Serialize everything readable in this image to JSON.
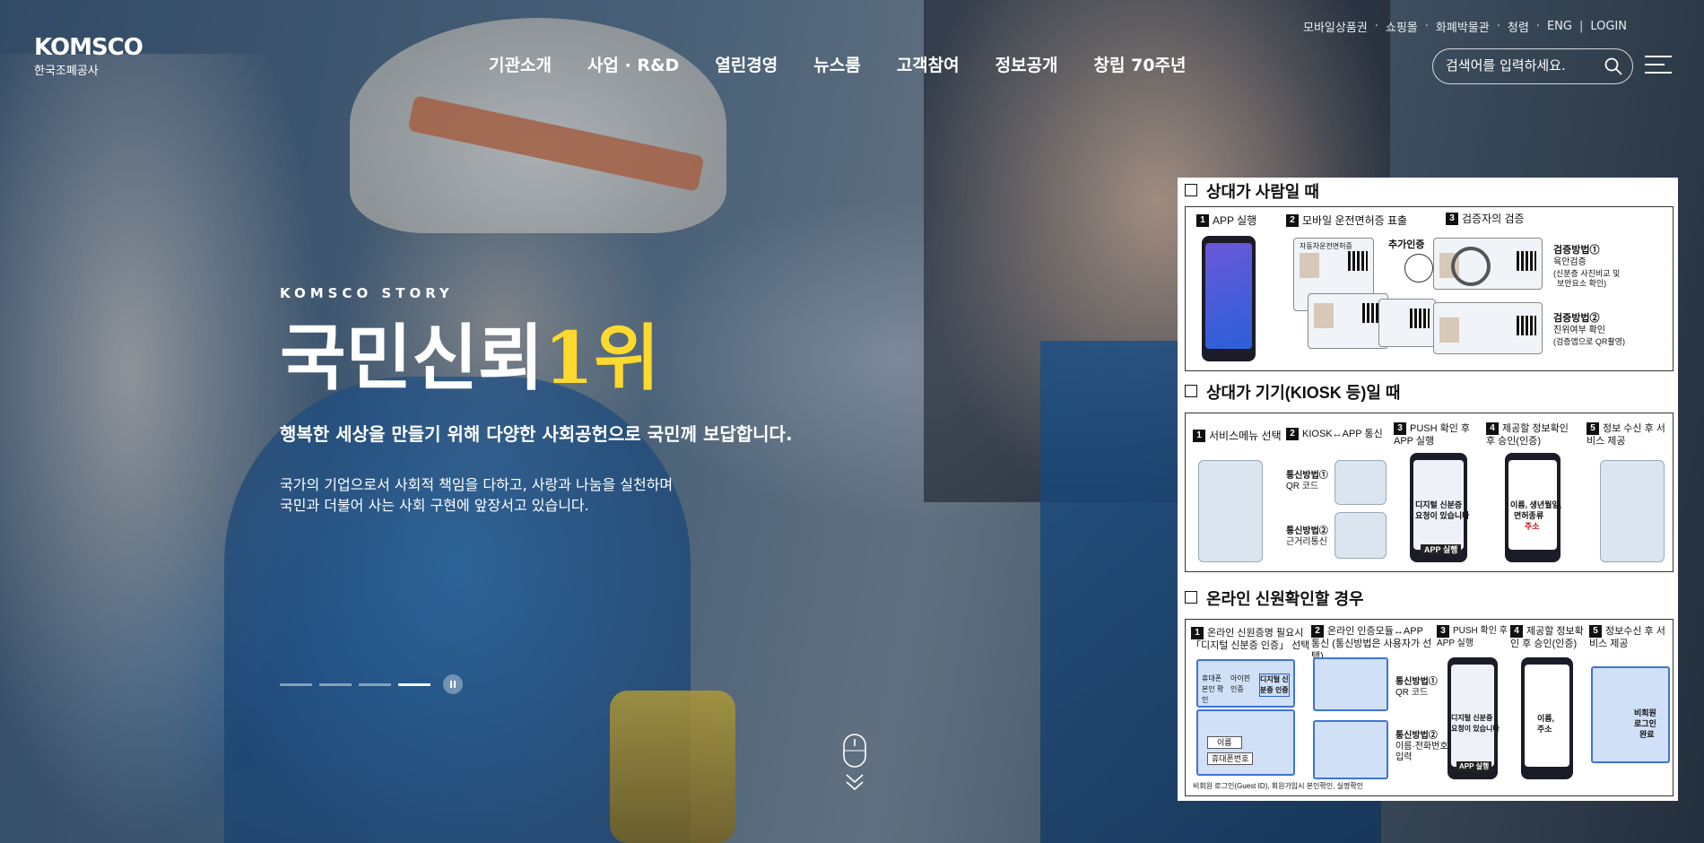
{
  "header": {
    "logo_mark": "KOMSCO",
    "logo_sub": "한국조폐공사",
    "nav": [
      "기관소개",
      "사업 · R&D",
      "열린경영",
      "뉴스룸",
      "고객참여",
      "정보공개",
      "창립 70주년"
    ],
    "util_links": [
      "모바일상품권",
      "쇼핑몰",
      "화폐박물관",
      "청렴",
      "ENG",
      "LOGIN"
    ],
    "search_placeholder": "검색어를 입력하세요."
  },
  "hero": {
    "kicker": "KOMSCO STORY",
    "title_main": "국민신뢰",
    "title_highlight": "1위",
    "lead": "행복한 세상을 만들기 위해 다양한 사회공헌으로 국민께 보답합니다.",
    "desc": [
      "국가의 기업으로서 사회적 책임을 다하고, 사랑과 나눔을 실천하며",
      "국민과 더불어 사는 사회 구현에 앞장서고 있습니다."
    ],
    "slide_count": 4,
    "active_slide": 4
  },
  "overlay": {
    "section1": {
      "title": "상대가 사람일 때",
      "steps": [
        "APP 실행",
        "모바일 운전면허증 표출",
        "검증자의 검증"
      ],
      "extra_auth": "추가인증",
      "license_title": "자동차운전면허증",
      "method1_title": "검증방법①",
      "method1_desc": [
        "육안검증",
        "(신분증 사진비교 및",
        "보안요소 확인)"
      ],
      "method2_title": "검증방법②",
      "method2_desc": [
        "진위여부 확인",
        "(검증앱으로 QR촬영)"
      ]
    },
    "section2": {
      "title": "상대가 기기(KIOSK 등)일 때",
      "steps": [
        "서비스메뉴 선택",
        "KIOSK↔APP 통신",
        "PUSH 확인 후 APP 실행",
        "제공할 정보확인 후 승인(인증)",
        "정보 수신 후 서비스 제공"
      ],
      "comm1_title": "통신방법①",
      "comm1_desc": "QR 코드",
      "comm2_title": "통신방법②",
      "comm2_desc": "근거리통신",
      "push_text": [
        "디지털 신분증",
        "요청이 있습니다"
      ],
      "app_run": "APP 실행",
      "consent_text": [
        "이름, 생년월일,",
        "면허종류",
        "주소"
      ]
    },
    "section3": {
      "title": "온라인 신원확인할 경우",
      "steps": [
        "온라인 신원증명 필요시 「디지털 신분증 인증」 선택",
        "온라인 인증모듈↔APP 통신 (통신방법은 사용자가 선택)",
        "PUSH 확인 후 APP 실행",
        "제공할 정보확인 후 승인(인증)",
        "정보수신 후 서비스 제공"
      ],
      "comm1_title": "통신방법①",
      "comm1_desc": "QR 코드",
      "comm2_title": "통신방법②",
      "comm2_desc": [
        "이름·전화번호",
        "입력"
      ],
      "login_options": [
        "휴대폰 본인 확인",
        "아이핀 인증",
        "디지털 신분증 인증"
      ],
      "name_label": "이름",
      "phone_label": "휴대폰번호",
      "done_text": [
        "비회원",
        "로그인",
        "완료"
      ],
      "push_text": [
        "디지털 신분증",
        "요청이 있습니다"
      ],
      "app_run": "APP 실행",
      "consent_text": [
        "이름,",
        "주소"
      ],
      "footnote": "비회원 로그인(Guest ID), 회원가입시 본인확인, 실명확인"
    }
  }
}
